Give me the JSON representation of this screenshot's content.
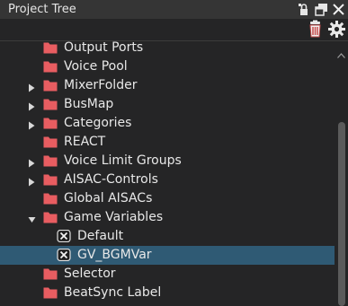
{
  "window": {
    "title": "Project Tree"
  },
  "toolbar": {
    "delete_icon": "trash-icon",
    "settings_icon": "gear-icon"
  },
  "tree": {
    "items": [
      {
        "label": "Output Ports",
        "expander": "none",
        "icon": "folder",
        "level": 1
      },
      {
        "label": "Voice Pool",
        "expander": "none",
        "icon": "folder",
        "level": 1
      },
      {
        "label": "MixerFolder",
        "expander": "collapsed",
        "icon": "folder",
        "level": 1
      },
      {
        "label": "BusMap",
        "expander": "collapsed",
        "icon": "folder",
        "level": 1
      },
      {
        "label": "Categories",
        "expander": "collapsed",
        "icon": "folder",
        "level": 1
      },
      {
        "label": "REACT",
        "expander": "none",
        "icon": "folder",
        "level": 1
      },
      {
        "label": "Voice Limit Groups",
        "expander": "collapsed",
        "icon": "folder",
        "level": 1
      },
      {
        "label": "AISAC-Controls",
        "expander": "collapsed",
        "icon": "folder",
        "level": 1
      },
      {
        "label": "Global AISACs",
        "expander": "none",
        "icon": "folder",
        "level": 1
      },
      {
        "label": "Game Variables",
        "expander": "expanded",
        "icon": "folder",
        "level": 1
      },
      {
        "label": "Default",
        "expander": "none",
        "icon": "variable",
        "level": 2
      },
      {
        "label": "GV_BGMVar",
        "expander": "none",
        "icon": "variable",
        "level": 2,
        "selected": true
      },
      {
        "label": "Selector",
        "expander": "none",
        "icon": "folder",
        "level": 1
      },
      {
        "label": "BeatSync Label",
        "expander": "none",
        "icon": "folder",
        "level": 1
      }
    ]
  },
  "colors": {
    "folder": "#e85d61",
    "selection": "#2f5a74",
    "text": "#e8e8e8"
  }
}
